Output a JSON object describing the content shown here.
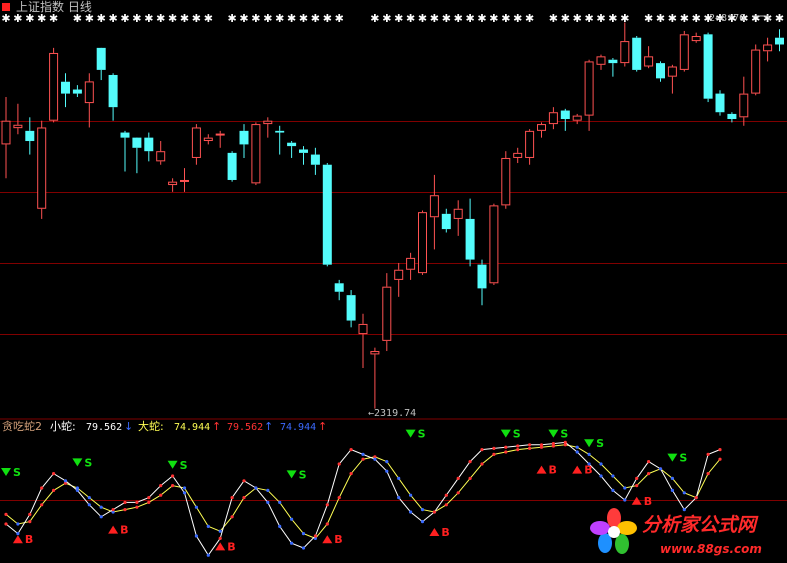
{
  "window": {
    "title": "上证指数 日线"
  },
  "colors": {
    "background": "#000000",
    "bear": "#54FCFC",
    "bull": "#FF5252",
    "grid": "#800000",
    "label": "#C0C0C0",
    "indicator_name": "#D2A07A",
    "small_snake": "#FFFFFF",
    "big_snake": "#FFFF54",
    "up": "#FF3333",
    "down": "#3B6BFF",
    "buy": "#FF2020",
    "sell": "#10E010",
    "watermark": "#FF2A2A"
  },
  "main_chart": {
    "high_label": "2←8*76",
    "low_label": "←2319.74"
  },
  "indicator": {
    "name": "贪吃蛇2",
    "small_label": "小蛇:",
    "small_value": "79.562",
    "small_arrow": "↓",
    "big_label": "大蛇:",
    "big_value": "74.944",
    "big_arrow": "↑",
    "extra1_value": "79.562",
    "extra1_arrow": "↑",
    "extra2_value": "74.944",
    "extra2_arrow": "↑",
    "buy_label": "B",
    "sell_label": "S"
  },
  "watermark": {
    "name": "分析家公式网",
    "url": "www.88gs.com"
  },
  "chart_data": {
    "type": "candlestick",
    "candles": [
      {
        "o": 3100,
        "c": 3170,
        "h": 3240,
        "l": 3000,
        "dir": "up"
      },
      {
        "o": 3158,
        "c": 3148,
        "h": 3220,
        "l": 3130,
        "dir": "up"
      },
      {
        "o": 3110,
        "c": 3140,
        "h": 3180,
        "l": 3070,
        "dir": "down"
      },
      {
        "o": 2910,
        "c": 3150,
        "h": 3170,
        "l": 2880,
        "dir": "up"
      },
      {
        "o": 3170,
        "c": 3370,
        "h": 3385,
        "l": 3165,
        "dir": "up"
      },
      {
        "o": 3285,
        "c": 3250,
        "h": 3310,
        "l": 3210,
        "dir": "down"
      },
      {
        "o": 3262,
        "c": 3250,
        "h": 3275,
        "l": 3240,
        "dir": "down"
      },
      {
        "o": 3222,
        "c": 3286,
        "h": 3310,
        "l": 3150,
        "dir": "up"
      },
      {
        "o": 3385,
        "c": 3320,
        "h": 3345,
        "l": 3290,
        "dir": "down"
      },
      {
        "o": 3305,
        "c": 3210,
        "h": 3310,
        "l": 3170,
        "dir": "down"
      },
      {
        "o": 3135,
        "c": 3120,
        "h": 3140,
        "l": 3020,
        "dir": "down"
      },
      {
        "o": 3120,
        "c": 3090,
        "h": 3105,
        "l": 3015,
        "dir": "down"
      },
      {
        "o": 3120,
        "c": 3080,
        "h": 3135,
        "l": 3050,
        "dir": "down"
      },
      {
        "o": 3050,
        "c": 3080,
        "h": 3110,
        "l": 3040,
        "dir": "up"
      },
      {
        "o": 2990,
        "c": 2980,
        "h": 3000,
        "l": 2960,
        "dir": "up"
      },
      {
        "o": 2990,
        "c": 2995,
        "h": 3030,
        "l": 2960,
        "dir": "up"
      },
      {
        "o": 3060,
        "c": 3150,
        "h": 3160,
        "l": 3040,
        "dir": "up"
      },
      {
        "o": 3120,
        "c": 3110,
        "h": 3130,
        "l": 3100,
        "dir": "up"
      },
      {
        "o": 3128,
        "c": 3132,
        "h": 3140,
        "l": 3090,
        "dir": "up"
      },
      {
        "o": 3075,
        "c": 2995,
        "h": 3080,
        "l": 2990,
        "dir": "down"
      },
      {
        "o": 3140,
        "c": 3100,
        "h": 3160,
        "l": 3060,
        "dir": "down"
      },
      {
        "o": 2985,
        "c": 3160,
        "h": 3165,
        "l": 2980,
        "dir": "up"
      },
      {
        "o": 3160,
        "c": 3170,
        "h": 3180,
        "l": 3120,
        "dir": "up"
      },
      {
        "o": 3140,
        "c": 3135,
        "h": 3155,
        "l": 3070,
        "dir": "down"
      },
      {
        "o": 3105,
        "c": 3095,
        "h": 3110,
        "l": 3060,
        "dir": "down"
      },
      {
        "o": 3085,
        "c": 3075,
        "h": 3095,
        "l": 3040,
        "dir": "down"
      },
      {
        "o": 3070,
        "c": 3040,
        "h": 3090,
        "l": 3010,
        "dir": "down"
      },
      {
        "o": 3040,
        "c": 2745,
        "h": 3045,
        "l": 2740,
        "dir": "down"
      },
      {
        "o": 2690,
        "c": 2665,
        "h": 2700,
        "l": 2640,
        "dir": "down"
      },
      {
        "o": 2655,
        "c": 2580,
        "h": 2670,
        "l": 2560,
        "dir": "down"
      },
      {
        "o": 2540,
        "c": 2570,
        "h": 2600,
        "l": 2440,
        "dir": "up"
      },
      {
        "o": 2480,
        "c": 2490,
        "h": 2500,
        "l": 2320,
        "dir": "up"
      },
      {
        "o": 2520,
        "c": 2680,
        "h": 2720,
        "l": 2490,
        "dir": "up"
      },
      {
        "o": 2700,
        "c": 2730,
        "h": 2750,
        "l": 2650,
        "dir": "up"
      },
      {
        "o": 2730,
        "c": 2765,
        "h": 2780,
        "l": 2700,
        "dir": "up"
      },
      {
        "o": 2720,
        "c": 2900,
        "h": 2905,
        "l": 2715,
        "dir": "up"
      },
      {
        "o": 2885,
        "c": 2950,
        "h": 3010,
        "l": 2790,
        "dir": "up"
      },
      {
        "o": 2895,
        "c": 2850,
        "h": 2910,
        "l": 2840,
        "dir": "down"
      },
      {
        "o": 2880,
        "c": 2910,
        "h": 2935,
        "l": 2830,
        "dir": "up"
      },
      {
        "o": 2880,
        "c": 2760,
        "h": 2940,
        "l": 2740,
        "dir": "down"
      },
      {
        "o": 2745,
        "c": 2675,
        "h": 2760,
        "l": 2625,
        "dir": "down"
      },
      {
        "o": 2690,
        "c": 2920,
        "h": 2925,
        "l": 2685,
        "dir": "up"
      },
      {
        "o": 2920,
        "c": 3060,
        "h": 3080,
        "l": 2910,
        "dir": "up"
      },
      {
        "o": 3060,
        "c": 3075,
        "h": 3090,
        "l": 3045,
        "dir": "up"
      },
      {
        "o": 3060,
        "c": 3140,
        "h": 3145,
        "l": 3040,
        "dir": "up"
      },
      {
        "o": 3140,
        "c": 3160,
        "h": 3165,
        "l": 3120,
        "dir": "up"
      },
      {
        "o": 3160,
        "c": 3195,
        "h": 3210,
        "l": 3145,
        "dir": "up"
      },
      {
        "o": 3200,
        "c": 3175,
        "h": 3205,
        "l": 3140,
        "dir": "down"
      },
      {
        "o": 3170,
        "c": 3185,
        "h": 3190,
        "l": 3160,
        "dir": "up"
      },
      {
        "o": 3185,
        "c": 3345,
        "h": 3350,
        "l": 3140,
        "dir": "up"
      },
      {
        "o": 3335,
        "c": 3360,
        "h": 3365,
        "l": 3320,
        "dir": "up"
      },
      {
        "o": 3350,
        "c": 3340,
        "h": 3355,
        "l": 3300,
        "dir": "down"
      },
      {
        "o": 3340,
        "c": 3405,
        "h": 3460,
        "l": 3330,
        "dir": "up"
      },
      {
        "o": 3415,
        "c": 3320,
        "h": 3420,
        "l": 3315,
        "dir": "down"
      },
      {
        "o": 3330,
        "c": 3360,
        "h": 3390,
        "l": 3325,
        "dir": "up"
      },
      {
        "o": 3340,
        "c": 3295,
        "h": 3345,
        "l": 3285,
        "dir": "down"
      },
      {
        "o": 3300,
        "c": 3330,
        "h": 3335,
        "l": 3250,
        "dir": "up"
      },
      {
        "o": 3320,
        "c": 3425,
        "h": 3435,
        "l": 3315,
        "dir": "up"
      },
      {
        "o": 3420,
        "c": 3405,
        "h": 3430,
        "l": 3400,
        "dir": "up"
      },
      {
        "o": 3425,
        "c": 3235,
        "h": 3430,
        "l": 3225,
        "dir": "down"
      },
      {
        "o": 3250,
        "c": 3195,
        "h": 3260,
        "l": 3185,
        "dir": "down"
      },
      {
        "o": 3190,
        "c": 3175,
        "h": 3195,
        "l": 3165,
        "dir": "down"
      },
      {
        "o": 3180,
        "c": 3250,
        "h": 3300,
        "l": 3155,
        "dir": "up"
      },
      {
        "o": 3250,
        "c": 3380,
        "h": 3395,
        "l": 3245,
        "dir": "up"
      },
      {
        "o": 3375,
        "c": 3395,
        "h": 3415,
        "l": 3345,
        "dir": "up"
      },
      {
        "o": 3415,
        "c": 3395,
        "h": 3440,
        "l": 3375,
        "dir": "down"
      }
    ],
    "high_value": 3460,
    "low_value": 2319.74,
    "grid_lines": [
      3170,
      2960,
      2750,
      2540
    ],
    "x_markers": [
      0,
      1,
      2,
      3,
      4,
      6,
      7,
      8,
      9,
      10,
      11,
      12,
      13,
      14,
      15,
      16,
      17,
      19,
      20,
      21,
      22,
      23,
      24,
      25,
      26,
      27,
      28,
      31,
      32,
      33,
      34,
      35,
      36,
      37,
      38,
      39,
      40,
      41,
      42,
      43,
      44,
      46,
      47,
      48,
      49,
      50,
      51,
      52,
      54,
      55,
      56,
      57,
      58,
      59,
      60,
      61,
      62,
      63,
      64,
      65
    ],
    "indicator_range": [
      0,
      100
    ],
    "indicator_grid": [
      50
    ],
    "small_snake": [
      30,
      22,
      38,
      60,
      72,
      66,
      58,
      46,
      36,
      42,
      48,
      48,
      52,
      62,
      70,
      56,
      20,
      4,
      18,
      52,
      66,
      60,
      48,
      28,
      14,
      10,
      20,
      46,
      80,
      92,
      88,
      84,
      74,
      52,
      40,
      32,
      40,
      54,
      68,
      82,
      92,
      93,
      94,
      95,
      96,
      96,
      97,
      98,
      90,
      80,
      70,
      58,
      50,
      68,
      82,
      76,
      58,
      42,
      52,
      88,
      92
    ],
    "big_snake": [
      38,
      30,
      32,
      46,
      58,
      64,
      60,
      52,
      44,
      40,
      42,
      44,
      48,
      54,
      62,
      60,
      44,
      28,
      24,
      36,
      52,
      60,
      58,
      48,
      34,
      22,
      18,
      30,
      52,
      72,
      84,
      86,
      82,
      68,
      54,
      42,
      40,
      46,
      56,
      68,
      80,
      88,
      90,
      92,
      93,
      94,
      95,
      96,
      94,
      88,
      80,
      70,
      60,
      62,
      72,
      76,
      68,
      56,
      52,
      72,
      84
    ],
    "buy_signals": [
      {
        "i": 1,
        "v": 14
      },
      {
        "i": 9,
        "v": 22
      },
      {
        "i": 18,
        "v": 8
      },
      {
        "i": 27,
        "v": 14
      },
      {
        "i": 36,
        "v": 20
      },
      {
        "i": 45,
        "v": 72
      },
      {
        "i": 48,
        "v": 72
      },
      {
        "i": 53,
        "v": 46
      }
    ],
    "sell_signals": [
      {
        "i": 0,
        "v": 70
      },
      {
        "i": 6,
        "v": 78
      },
      {
        "i": 14,
        "v": 76
      },
      {
        "i": 24,
        "v": 68
      },
      {
        "i": 34,
        "v": 102
      },
      {
        "i": 42,
        "v": 102
      },
      {
        "i": 46,
        "v": 102
      },
      {
        "i": 49,
        "v": 94
      },
      {
        "i": 56,
        "v": 82
      }
    ]
  }
}
